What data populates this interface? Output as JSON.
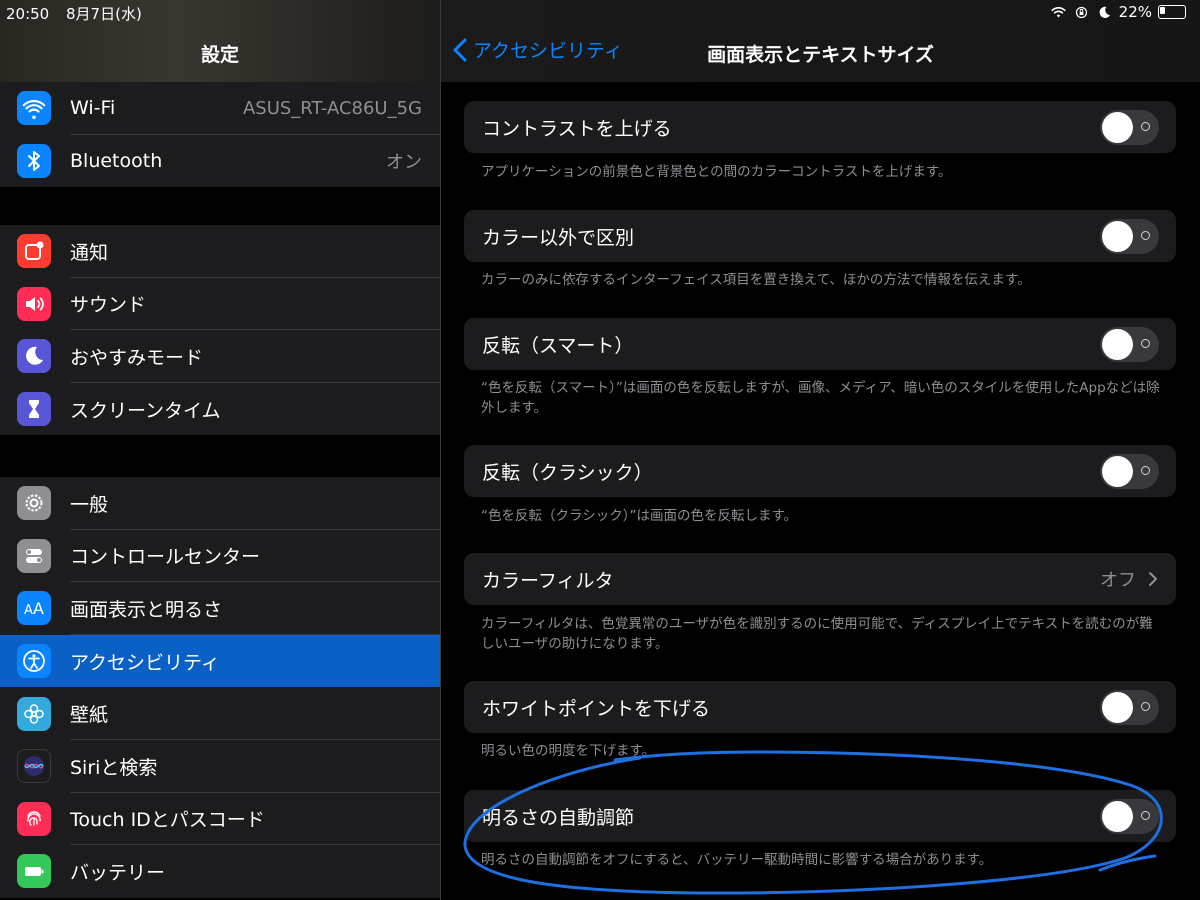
{
  "status_bar": {
    "time": "20:50",
    "date": "8月7日(水)",
    "battery": "22%"
  },
  "sidebar": {
    "title": "設定",
    "groups": [
      {
        "items": [
          {
            "label": "Wi-Fi",
            "value": "ASUS_RT-AC86U_5G",
            "icon": "wifi-icon",
            "color": "#0a84ff"
          },
          {
            "label": "Bluetooth",
            "value": "オン",
            "icon": "bluetooth-icon",
            "color": "#0a84ff"
          }
        ]
      },
      {
        "items": [
          {
            "label": "通知",
            "icon": "notifications-icon",
            "color": "#ff3b30"
          },
          {
            "label": "サウンド",
            "icon": "speaker-icon",
            "color": "#ff2d55"
          },
          {
            "label": "おやすみモード",
            "icon": "moon-icon",
            "color": "#5856d6"
          },
          {
            "label": "スクリーンタイム",
            "icon": "hourglass-icon",
            "color": "#5856d6"
          }
        ]
      },
      {
        "items": [
          {
            "label": "一般",
            "icon": "gear-icon",
            "color": "#8e8e93"
          },
          {
            "label": "コントロールセンター",
            "icon": "switches-icon",
            "color": "#8e8e93"
          },
          {
            "label": "画面表示と明るさ",
            "icon": "text-size-icon",
            "color": "#0a84ff"
          },
          {
            "label": "アクセシビリティ",
            "icon": "accessibility-icon",
            "color": "#0a84ff",
            "selected": true
          },
          {
            "label": "壁紙",
            "icon": "flower-icon",
            "color": "#34aadc"
          },
          {
            "label": "Siriと検索",
            "icon": "siri-icon",
            "color": "#1c1c1e"
          },
          {
            "label": "Touch IDとパスコード",
            "icon": "fingerprint-icon",
            "color": "#ff2d55"
          },
          {
            "label": "バッテリー",
            "icon": "battery-icon",
            "color": "#34c759"
          }
        ]
      }
    ]
  },
  "detail": {
    "back_label": "アクセシビリティ",
    "title": "画面表示とテキストサイズ",
    "settings": [
      {
        "label": "コントラストを上げる",
        "toggle": false,
        "footer": "アプリケーションの前景色と背景色との間のカラーコントラストを上げます。"
      },
      {
        "label": "カラー以外で区別",
        "toggle": false,
        "footer": "カラーのみに依存するインターフェイス項目を置き換えて、ほかの方法で情報を伝えます。"
      },
      {
        "label": "反転（スマート）",
        "toggle": false,
        "footer": "“色を反転（スマート）”は画面の色を反転しますが、画像、メディア、暗い色のスタイルを使用したAppなどは除外します。"
      },
      {
        "label": "反転（クラシック）",
        "toggle": false,
        "footer": "“色を反転（クラシック）”は画面の色を反転します。"
      },
      {
        "label": "カラーフィルタ",
        "value": "オフ",
        "footer": "カラーフィルタは、色覚異常のユーザが色を識別するのに使用可能で、ディスプレイ上でテキストを読むのが難しいユーザの助けになります。"
      },
      {
        "label": "ホワイトポイントを下げる",
        "toggle": false,
        "footer": "明るい色の明度を下げます。"
      },
      {
        "label": "明るさの自動調節",
        "toggle": false,
        "footer": "明るさの自動調節をオフにすると、バッテリー駆動時間に影響する場合があります。"
      }
    ]
  },
  "colors": {
    "accent": "#0a84ff",
    "selected": "#0a60c4",
    "annotation": "#1e6fe0"
  }
}
